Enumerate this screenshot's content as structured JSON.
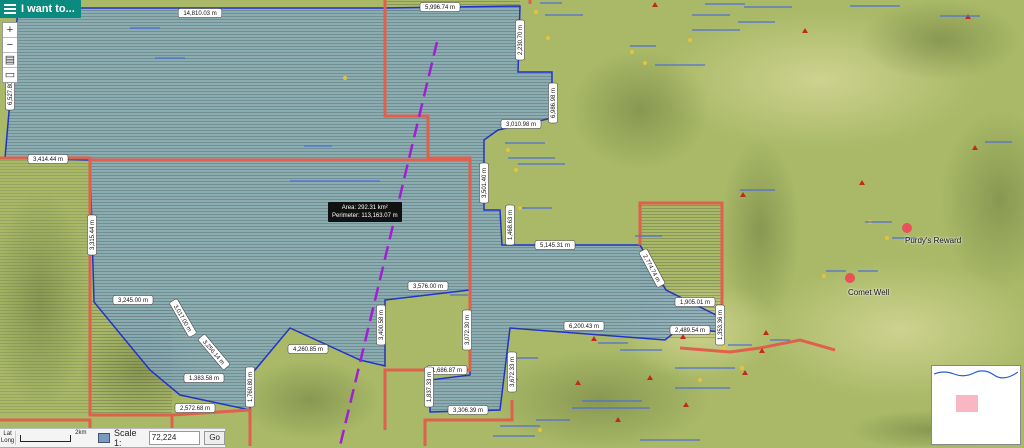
{
  "app": {
    "menu_label": "I want to..."
  },
  "tools": {
    "zoom_in": "+",
    "zoom_out": "−"
  },
  "colors": {
    "polygon_fill": "#7fa9cc",
    "polygon_line": "#2233cc",
    "boundary": "#e06050",
    "dash": "#a020d0",
    "teal": "#0b8a80"
  },
  "measure": {
    "area": "Area: 292.31 km²",
    "perimeter": "Perimeter: 113,163.07 m"
  },
  "segments": [
    "14,810.03 m",
    "5,996.74 m",
    "2,230.70 m",
    "6,527.80 m",
    "6,986.98 m",
    "3,010.98 m",
    "3,414.44 m",
    "3,501.40 m",
    "3,315.44 m",
    "1,468.63 m",
    "5,145.31 m",
    "2,774.74 m",
    "1,905.01 m",
    "1,353.36 m",
    "6,200.43 m",
    "2,489.54 m",
    "3,576.00 m",
    "3,245.00 m",
    "3,017.00 m",
    "3,256.14 m",
    "4,260.85 m",
    "3,400.58 m",
    "3,072.30 m",
    "1,383.58 m",
    "1,760.80 m",
    "2,572.68 m",
    "1,686.87 m",
    "1,837.33 m",
    "3,672.33 m",
    "3,306.39 m"
  ],
  "places": {
    "purdys_reward": "Purdy's Reward",
    "comet_well": "Comet Well"
  },
  "scale": {
    "label": "Scale 1:",
    "value": "72,224",
    "go": "Go",
    "lat": "Lat",
    "long": "Long",
    "bar_text": "2km"
  }
}
